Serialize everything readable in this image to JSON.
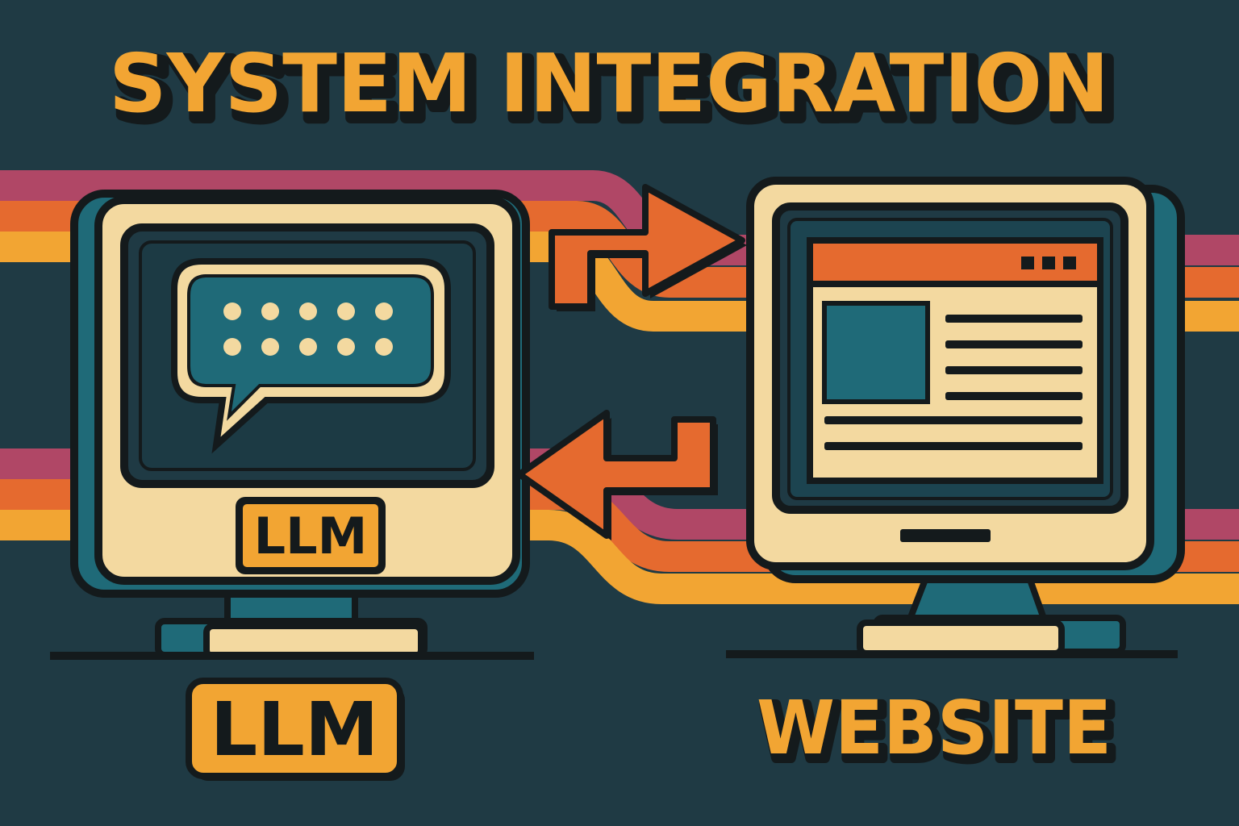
{
  "title": "SYSTEM INTEGRATION",
  "left_node": {
    "screen_badge": "LLM",
    "label": "LLM",
    "icon": "chat-bubble-icon"
  },
  "right_node": {
    "label": "WEBSITE",
    "icon": "browser-window-icon"
  },
  "flows": [
    {
      "direction": "llm-to-website",
      "icon": "arrow-right-icon"
    },
    {
      "direction": "website-to-llm",
      "icon": "arrow-left-icon"
    }
  ],
  "colors": {
    "background": "#1f3a44",
    "cream": "#f3d9a0",
    "outline": "#141a1c",
    "gold": "#f2a533",
    "orange": "#e56a2f",
    "magenta": "#b04766",
    "teal": "#1f6a78"
  }
}
